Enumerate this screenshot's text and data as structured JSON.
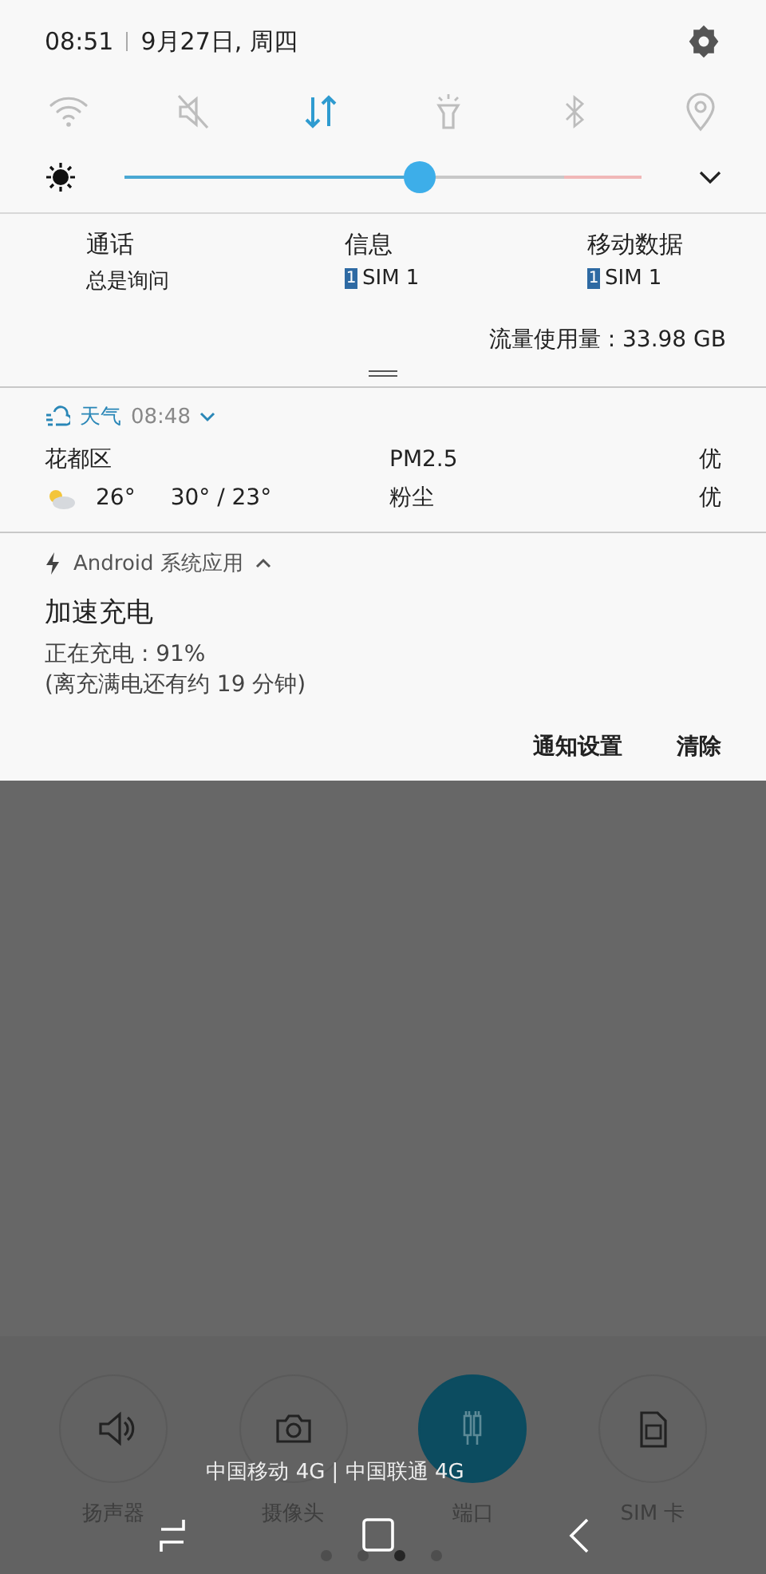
{
  "header": {
    "time": "08:51",
    "date": "9月27日, 周四"
  },
  "toggles": [
    {
      "kind": "wifi",
      "on": false
    },
    {
      "kind": "sound",
      "on": false
    },
    {
      "kind": "data",
      "on": true
    },
    {
      "kind": "flashlight",
      "on": false
    },
    {
      "kind": "bluetooth",
      "on": false
    },
    {
      "kind": "location",
      "on": false
    }
  ],
  "brightness": {
    "level": 0.57
  },
  "sim": [
    {
      "label": "通话",
      "value": "总是询问"
    },
    {
      "label": "信息",
      "value": "SIM 1",
      "badge": "1"
    },
    {
      "label": "移动数据",
      "value": "SIM 1",
      "badge": "1"
    }
  ],
  "data_usage": "流量使用量 : 33.98 GB",
  "weather": {
    "app": "天气",
    "time": "08:48",
    "city": "花都区",
    "temp": "26°",
    "range": "30° /  23°",
    "aq": [
      {
        "name": "PM2.5",
        "value": "优"
      },
      {
        "name": "粉尘",
        "value": "优"
      }
    ]
  },
  "notification": {
    "app": "Android 系统应用",
    "title": "加速充电",
    "lines": [
      "正在充电 : 91%",
      "(离充满电还有约 19 分钟)"
    ],
    "actions": [
      "通知设置",
      "清除"
    ]
  },
  "tiles": [
    {
      "kind": "speaker",
      "label": "扬声器",
      "selected": false
    },
    {
      "kind": "camera",
      "label": "摄像头",
      "selected": false
    },
    {
      "kind": "port",
      "label": "端口",
      "selected": true
    },
    {
      "kind": "sim",
      "label": "SIM 卡",
      "selected": false
    }
  ],
  "carrier": "中国移动 4G | 中国联通 4G",
  "page_dots": [
    {
      "selected": false
    },
    {
      "selected": false
    },
    {
      "selected": true
    },
    {
      "selected": false
    }
  ]
}
